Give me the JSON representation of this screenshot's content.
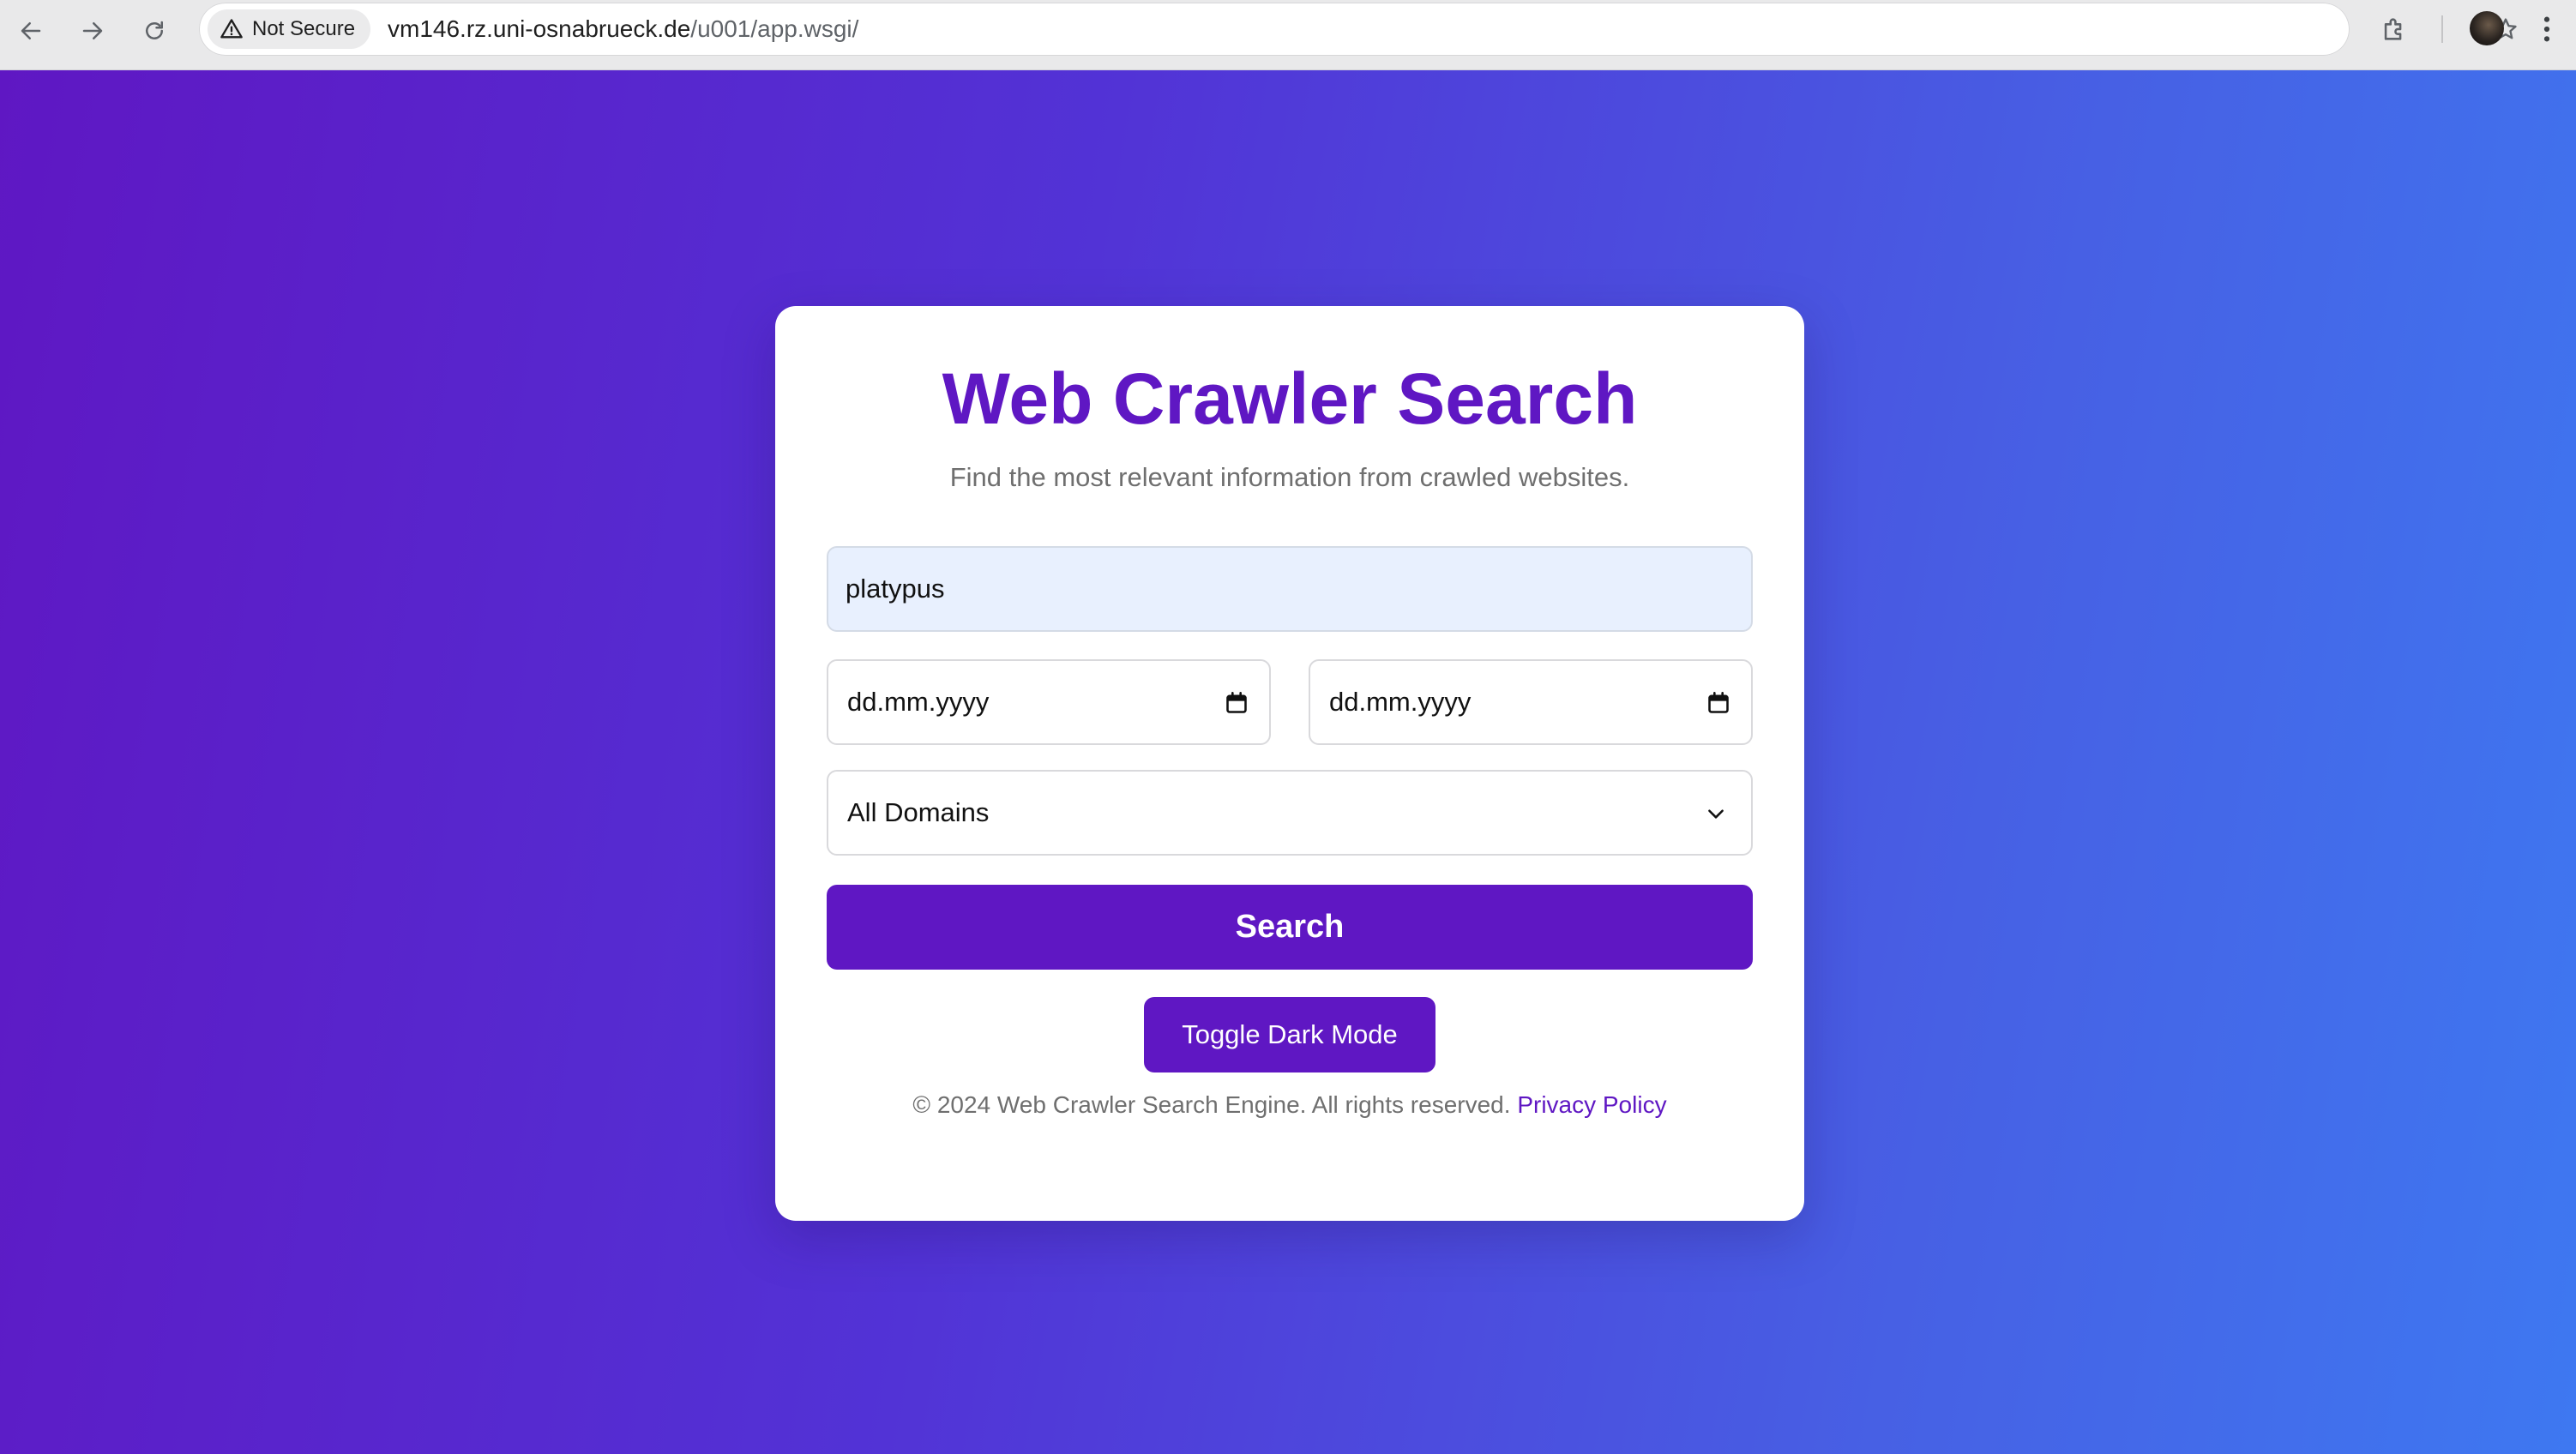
{
  "browser": {
    "security_label": "Not Secure",
    "url_host": "vm146.rz.uni-osnabrueck.de",
    "url_path": "/u001/app.wsgi/",
    "icons": {
      "back": "back-arrow-icon",
      "forward": "forward-arrow-icon",
      "reload": "reload-icon",
      "warning": "warning-triangle-icon",
      "bookmark": "star-icon",
      "extensions": "puzzle-icon",
      "menu": "kebab-menu-icon"
    }
  },
  "app": {
    "title": "Web Crawler Search",
    "subtitle": "Find the most relevant information from crawled websites.",
    "search": {
      "value": "platypus"
    },
    "date_from": {
      "placeholder": "dd.mm.yyyy"
    },
    "date_to": {
      "placeholder": "dd.mm.yyyy"
    },
    "domain_select": {
      "selected": "All Domains"
    },
    "search_button_label": "Search",
    "toggle_dark_mode_label": "Toggle Dark Mode",
    "footer": {
      "text": "© 2024 Web Crawler Search Engine. All rights reserved.",
      "privacy_link": "Privacy Policy"
    }
  },
  "colors": {
    "accent": "#5f17c3",
    "gradient_start": "#5f17c3",
    "gradient_end": "#3e78f1",
    "input_fill": "#e8f0fe"
  }
}
